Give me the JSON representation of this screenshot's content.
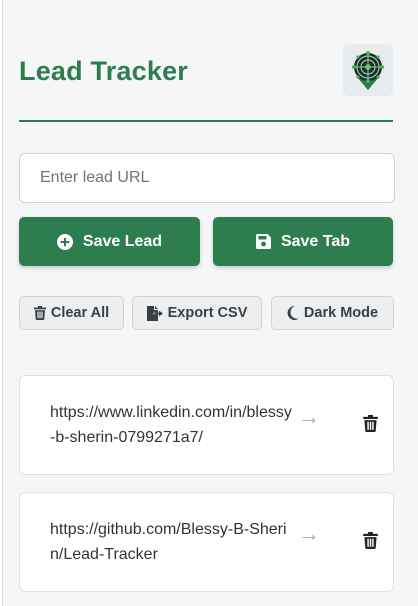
{
  "header": {
    "title": "Lead Tracker",
    "logo_icon": "radar-target-map-pin-icon"
  },
  "lead_input": {
    "placeholder": "Enter lead URL",
    "value": ""
  },
  "primary_actions": {
    "save_lead_label": "Save Lead",
    "save_lead_icon": "plus-circle-icon",
    "save_tab_label": "Save Tab",
    "save_tab_icon": "floppy-disk-icon"
  },
  "secondary_actions": {
    "clear_all_label": "Clear All",
    "clear_all_icon": "trash-icon",
    "export_csv_label": "Export CSV",
    "export_csv_icon": "file-export-icon",
    "dark_mode_label": "Dark Mode",
    "dark_mode_icon": "moon-icon"
  },
  "leads": [
    {
      "url": "https://www.linkedin.com/in/blessy-b-sherin-0799271a7/",
      "arrow": "→",
      "delete_icon": "trash-icon"
    },
    {
      "url": "https://github.com/Blessy-B-Sherin/Lead-Tracker",
      "arrow": "→",
      "delete_icon": "trash-icon"
    }
  ],
  "colors": {
    "accent": "#2e7d4f",
    "background": "#f4f6f8",
    "card": "#ffffff",
    "secondary_button": "#eceef0"
  }
}
